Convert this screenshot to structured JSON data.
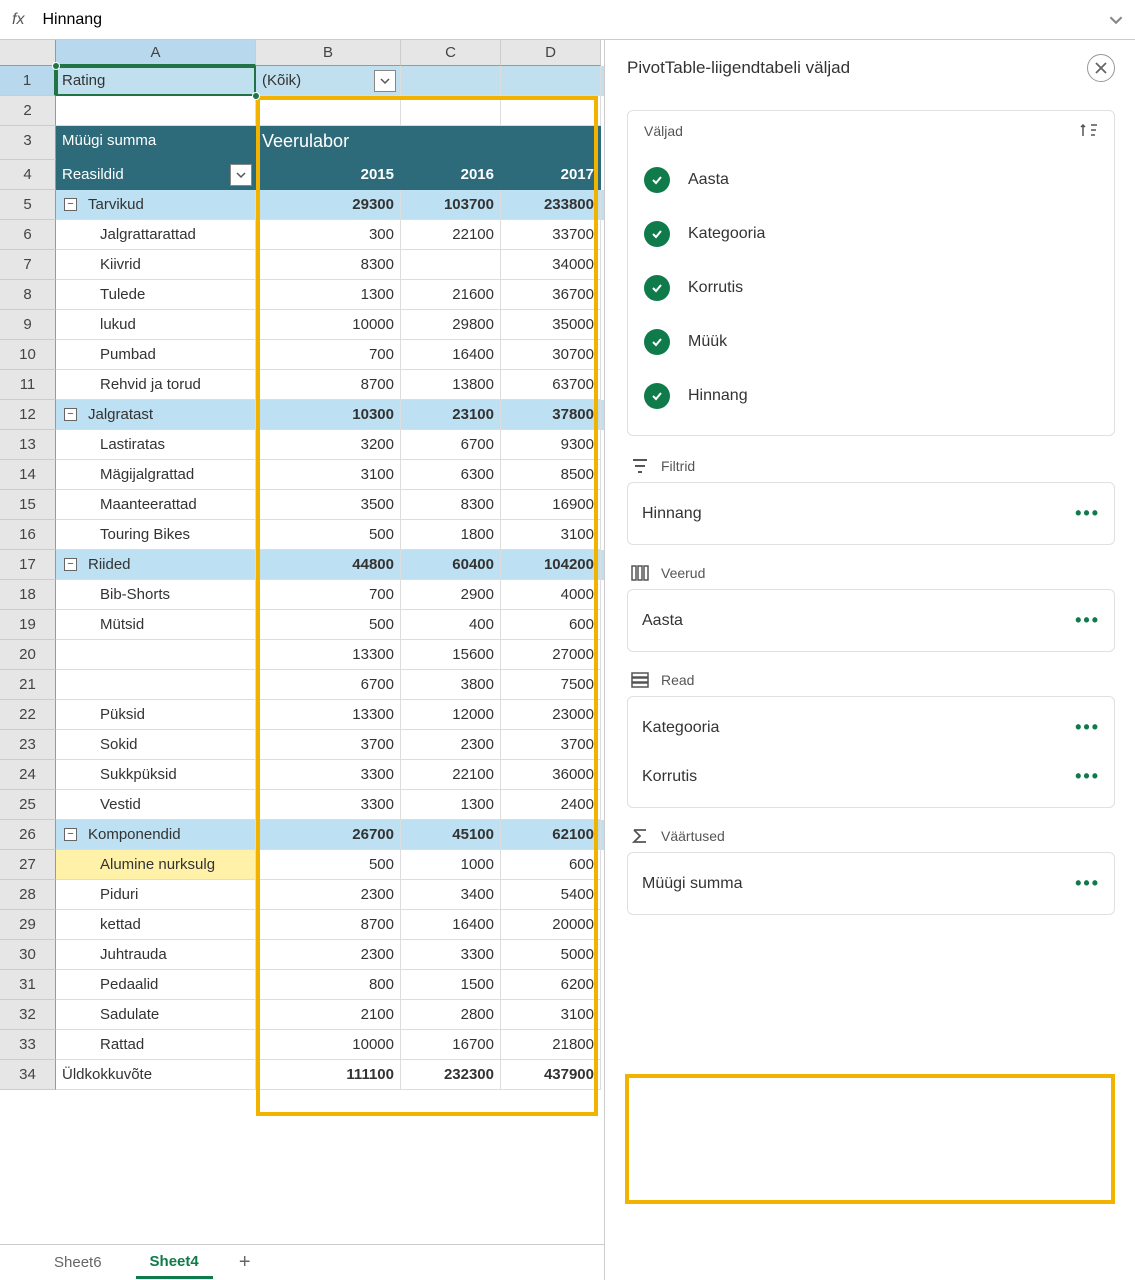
{
  "formula_bar": {
    "fx": "fx",
    "value": "Hinnang"
  },
  "columns": [
    "A",
    "B",
    "C",
    "D"
  ],
  "row_count": 34,
  "pivot": {
    "rating_label": "Rating",
    "rating_filter": "(Kõik)",
    "measure_label": "Müügi summa",
    "column_label": "Veerulabor",
    "row_labels_label": "Reasildid",
    "years": [
      "2015",
      "2016",
      "2017"
    ],
    "grand_total_label": "Üldkokkuvõte",
    "grand_total": [
      "111100",
      "232300",
      "437900"
    ],
    "groups": [
      {
        "name": "Tarvikud",
        "sub": [
          "29300",
          "103700",
          "233800"
        ],
        "items": [
          {
            "name": "Jalgrattarattad",
            "v": [
              "300",
              "22100",
              "33700"
            ]
          },
          {
            "name": "Kiivrid",
            "v": [
              "8300",
              "",
              "34000"
            ]
          },
          {
            "name": "Tulede",
            "v": [
              "1300",
              "21600",
              "36700"
            ]
          },
          {
            "name": "lukud",
            "v": [
              "10000",
              "29800",
              "35000"
            ]
          },
          {
            "name": "Pumbad",
            "v": [
              "700",
              "16400",
              "30700"
            ]
          },
          {
            "name": "Rehvid ja torud",
            "v": [
              "8700",
              "13800",
              "63700"
            ]
          }
        ]
      },
      {
        "name": "Jalgratast",
        "sub": [
          "10300",
          "23100",
          "37800"
        ],
        "items": [
          {
            "name": "Lastiratas",
            "v": [
              "3200",
              "6700",
              "9300"
            ]
          },
          {
            "name": "Mägijalgrattad",
            "v": [
              "3100",
              "6300",
              "8500"
            ]
          },
          {
            "name": "Maanteerattad",
            "v": [
              "3500",
              "8300",
              "16900"
            ]
          },
          {
            "name": "Touring Bikes",
            "v": [
              "500",
              "1800",
              "3100"
            ]
          }
        ]
      },
      {
        "name": "Riided",
        "sub": [
          "44800",
          "60400",
          "104200"
        ],
        "items": [
          {
            "name": "Bib-Shorts",
            "v": [
              "700",
              "2900",
              "4000"
            ]
          },
          {
            "name": "Mütsid",
            "v": [
              "500",
              "400",
              "600"
            ]
          },
          {
            "name": "",
            "v": [
              "13300",
              "15600",
              "27000"
            ]
          },
          {
            "name": "",
            "v": [
              "6700",
              "3800",
              "7500"
            ]
          },
          {
            "name": "Püksid",
            "v": [
              "13300",
              "12000",
              "23000"
            ]
          },
          {
            "name": "Sokid",
            "v": [
              "3700",
              "2300",
              "3700"
            ]
          },
          {
            "name": "Sukkpüksid",
            "v": [
              "3300",
              "22100",
              "36000"
            ]
          },
          {
            "name": "Vestid",
            "v": [
              "3300",
              "1300",
              "2400"
            ]
          }
        ]
      },
      {
        "name": "Komponendid",
        "sub": [
          "26700",
          "45100",
          "62100"
        ],
        "items": [
          {
            "name": "Alumine nurksulg",
            "v": [
              "500",
              "1000",
              "600"
            ],
            "hl": true
          },
          {
            "name": "Piduri",
            "v": [
              "2300",
              "3400",
              "5400"
            ]
          },
          {
            "name": "kettad",
            "v": [
              "8700",
              "16400",
              "20000"
            ]
          },
          {
            "name": "Juhtrauda",
            "v": [
              "2300",
              "3300",
              "5000"
            ]
          },
          {
            "name": "Pedaalid",
            "v": [
              "800",
              "1500",
              "6200"
            ]
          },
          {
            "name": "Sadulate",
            "v": [
              "2100",
              "2800",
              "3100"
            ]
          },
          {
            "name": "Rattad",
            "v": [
              "10000",
              "16700",
              "21800"
            ]
          }
        ]
      }
    ]
  },
  "sheets": {
    "tabs": [
      "Sheet6",
      "Sheet4"
    ],
    "active": 1
  },
  "pane": {
    "title": "PivotTable-liigendtabeli väljad",
    "fields_label": "Väljad",
    "fields": [
      "Aasta",
      "Kategooria",
      "Korrutis",
      "Müük",
      "Hinnang"
    ],
    "filters_label": "Filtrid",
    "filters": [
      "Hinnang"
    ],
    "columns_label": "Veerud",
    "columns_items": [
      "Aasta"
    ],
    "rows_label": "Read",
    "rows_items": [
      "Kategooria",
      "Korrutis"
    ],
    "values_label": "Väärtused",
    "values_items": [
      "Müügi summa"
    ]
  }
}
